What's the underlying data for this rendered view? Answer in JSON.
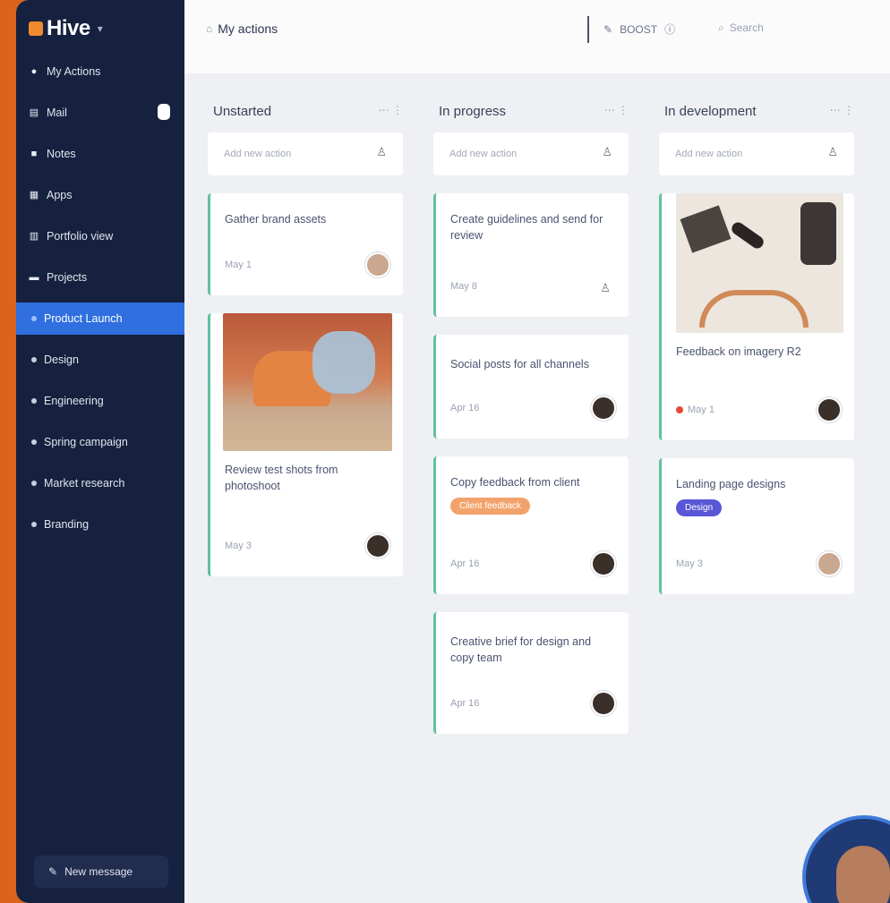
{
  "app": {
    "name": "Hive"
  },
  "sidebar": {
    "items": [
      {
        "label": "My Actions",
        "icon": "person-icon"
      },
      {
        "label": "Mail",
        "icon": "mail-icon",
        "badge": true
      },
      {
        "label": "Notes",
        "icon": "notes-icon"
      },
      {
        "label": "Apps",
        "icon": "apps-icon"
      },
      {
        "label": "Portfolio view",
        "icon": "portfolio-icon"
      },
      {
        "label": "Projects",
        "icon": "folder-icon"
      },
      {
        "label": "Product Launch",
        "icon": "dot",
        "active": true
      },
      {
        "label": "Design",
        "icon": "dot"
      },
      {
        "label": "Engineering",
        "icon": "dot"
      },
      {
        "label": "Spring campaign",
        "icon": "dot"
      },
      {
        "label": "Market research",
        "icon": "dot"
      },
      {
        "label": "Branding",
        "icon": "dot"
      }
    ],
    "new_message": "New message"
  },
  "topbar": {
    "title": "My actions",
    "tools_label": "BOOST",
    "search_placeholder": "Search"
  },
  "board": {
    "add_action_placeholder": "Add new action",
    "columns": [
      {
        "title": "Unstarted",
        "cards": [
          {
            "title": "Gather brand assets",
            "meta": "May 1"
          },
          {
            "title": "Review test shots from photoshoot",
            "meta": "May 3"
          }
        ]
      },
      {
        "title": "In progress",
        "cards": [
          {
            "title": "Create guidelines and send for review",
            "meta": "May 8"
          },
          {
            "title": "Social posts for all channels",
            "meta": "Apr 16"
          },
          {
            "title": "Copy feedback from client",
            "tag": "Client feedback",
            "meta": "Apr 16"
          },
          {
            "title": "Creative brief for design and copy team",
            "meta": "Apr 16"
          }
        ]
      },
      {
        "title": "In development",
        "cards": [
          {
            "title": "Feedback on imagery R2",
            "meta": "May 1"
          },
          {
            "title": "Landing page designs",
            "tag": "Design",
            "meta": "May 3"
          }
        ]
      }
    ]
  },
  "colors": {
    "sidebar": "#16213f",
    "active": "#2f6fe0",
    "accent": "#5ec2a3",
    "frame": "#d9641a"
  }
}
